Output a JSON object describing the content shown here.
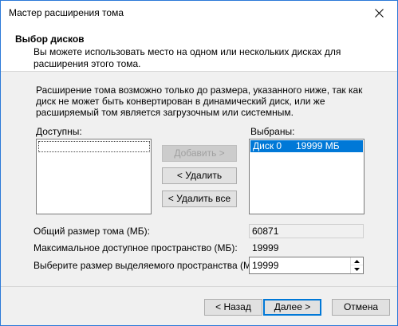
{
  "window": {
    "title": "Мастер расширения тома"
  },
  "header": {
    "title": "Выбор дисков",
    "subtitle": "Вы можете использовать место на одном или нескольких дисках для расширения этого тома."
  },
  "description": "Расширение тома возможно только до размера, указанного ниже, так как диск не может быть конвертирован в динамический диск, или же расширяемый том является загрузочным или системным.",
  "available": {
    "label": "Доступны:",
    "items": []
  },
  "selected": {
    "label": "Выбраны:",
    "items": [
      {
        "disk": "Диск 0",
        "size": "19999 МБ"
      }
    ]
  },
  "buttons": {
    "add": "Добавить >",
    "remove": "< Удалить",
    "remove_all": "< Удалить все",
    "back": "< Назад",
    "next": "Далее >",
    "cancel": "Отмена"
  },
  "fields": {
    "total_label": "Общий размер тома (МБ):",
    "total_value": "60871",
    "max_label": "Максимальное доступное пространство (МБ):",
    "max_value": "19999",
    "choose_label": "Выберите размер выделяемого пространства (МБ):",
    "choose_value": "19999"
  },
  "colors": {
    "accent": "#0078d7",
    "window_border": "#2b79d8"
  },
  "icons": {
    "close": "close-icon",
    "spin_up": "arrow-up-icon",
    "spin_down": "arrow-down-icon"
  }
}
